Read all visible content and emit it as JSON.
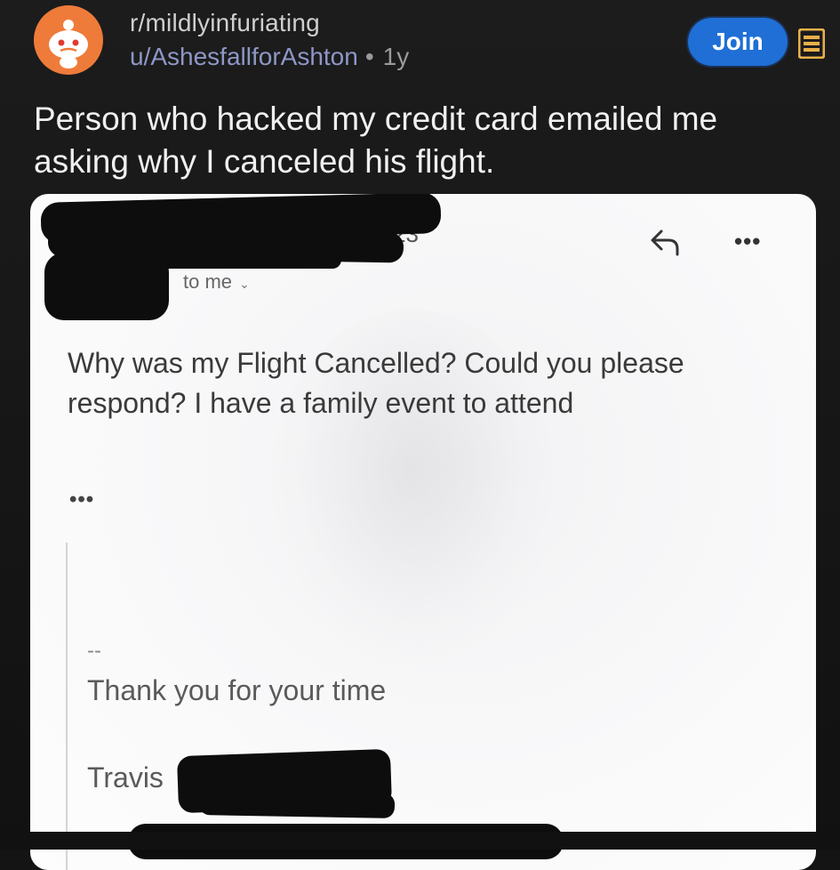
{
  "header": {
    "subreddit": "r/mildlyinfuriating",
    "username": "u/AshesfallforAshton",
    "separator": "•",
    "age": "1y",
    "join_label": "Join"
  },
  "post": {
    "title": "Person who hacked my credit card emailed me asking why I canceled his flight."
  },
  "email": {
    "date_fragment": "23",
    "recipient": "to me",
    "body": "Why was my Flight Cancelled? Could you please respond? I have a family event to attend",
    "ellipsis": "•••",
    "more_label": "•••",
    "signature_dashes": "--",
    "signature_thanks": "Thank you for your time",
    "signature_name": "Travis"
  },
  "colors": {
    "background": "#141414",
    "join_button": "#1f6fd6",
    "avatar": "#ef7b3a",
    "username": "#8e97c7",
    "menu_icon": "#e8b04a",
    "card": "#f9f9fa",
    "redaction": "#0d0d0d"
  },
  "icons": {
    "avatar": "reddit-snoo-icon",
    "menu": "menu-icon",
    "reply": "reply-arrow-icon",
    "more": "more-horizontal-icon",
    "dropdown": "chevron-down-icon"
  }
}
